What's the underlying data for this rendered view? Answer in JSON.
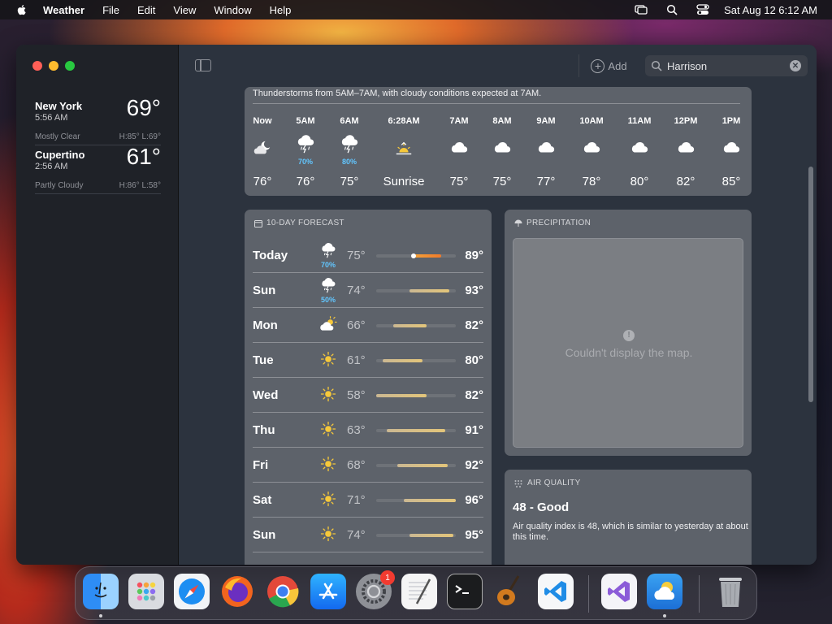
{
  "menubar": {
    "app_name": "Weather",
    "items": [
      "File",
      "Edit",
      "View",
      "Window",
      "Help"
    ],
    "clock": "Sat Aug 12  6:12 AM"
  },
  "sidebar": {
    "cities": [
      {
        "name": "New York",
        "time": "5:56 AM",
        "temp": "69°",
        "condition": "Mostly Clear",
        "hilo": "H:85°  L:69°"
      },
      {
        "name": "Cupertino",
        "time": "2:56 AM",
        "temp": "61°",
        "condition": "Partly Cloudy",
        "hilo": "H:86°  L:58°"
      }
    ]
  },
  "toolbar": {
    "add_label": "Add",
    "search_value": "Harrison"
  },
  "hourly": {
    "summary": "Thunderstorms from 5AM–7AM, with cloudy conditions expected at 7AM.",
    "hours": [
      {
        "label": "Now",
        "icon": "moon-cloud-icon",
        "precip": "",
        "temp": "76°"
      },
      {
        "label": "5AM",
        "icon": "thunderstorm-icon",
        "precip": "70%",
        "temp": "76°"
      },
      {
        "label": "6AM",
        "icon": "thunderstorm-icon",
        "precip": "80%",
        "temp": "75°"
      },
      {
        "label": "6:28AM",
        "icon": "sunrise-icon",
        "precip": "",
        "temp": "Sunrise"
      },
      {
        "label": "7AM",
        "icon": "cloud-icon",
        "precip": "",
        "temp": "75°"
      },
      {
        "label": "8AM",
        "icon": "cloud-icon",
        "precip": "",
        "temp": "75°"
      },
      {
        "label": "9AM",
        "icon": "cloud-icon",
        "precip": "",
        "temp": "77°"
      },
      {
        "label": "10AM",
        "icon": "cloud-icon",
        "precip": "",
        "temp": "78°"
      },
      {
        "label": "11AM",
        "icon": "cloud-icon",
        "precip": "",
        "temp": "80°"
      },
      {
        "label": "12PM",
        "icon": "cloud-icon",
        "precip": "",
        "temp": "82°"
      },
      {
        "label": "1PM",
        "icon": "cloud-icon",
        "precip": "",
        "temp": "85°"
      }
    ]
  },
  "tenday": {
    "title": "10-DAY FORECAST",
    "range_min": 58,
    "range_max": 96,
    "days": [
      {
        "name": "Today",
        "icon": "thunderstorm-icon",
        "precip": "70%",
        "low": "75°",
        "high": "89°",
        "low_n": 75,
        "high_n": 89,
        "current": 76
      },
      {
        "name": "Sun",
        "icon": "thunderstorm-icon",
        "precip": "50%",
        "low": "74°",
        "high": "93°",
        "low_n": 74,
        "high_n": 93
      },
      {
        "name": "Mon",
        "icon": "partly-cloudy-icon",
        "precip": "",
        "low": "66°",
        "high": "82°",
        "low_n": 66,
        "high_n": 82
      },
      {
        "name": "Tue",
        "icon": "sun-icon",
        "precip": "",
        "low": "61°",
        "high": "80°",
        "low_n": 61,
        "high_n": 80
      },
      {
        "name": "Wed",
        "icon": "sun-icon",
        "precip": "",
        "low": "58°",
        "high": "82°",
        "low_n": 58,
        "high_n": 82
      },
      {
        "name": "Thu",
        "icon": "sun-icon",
        "precip": "",
        "low": "63°",
        "high": "91°",
        "low_n": 63,
        "high_n": 91
      },
      {
        "name": "Fri",
        "icon": "sun-icon",
        "precip": "",
        "low": "68°",
        "high": "92°",
        "low_n": 68,
        "high_n": 92
      },
      {
        "name": "Sat",
        "icon": "sun-icon",
        "precip": "",
        "low": "71°",
        "high": "96°",
        "low_n": 71,
        "high_n": 96
      },
      {
        "name": "Sun",
        "icon": "sun-icon",
        "precip": "",
        "low": "74°",
        "high": "95°",
        "low_n": 74,
        "high_n": 95
      }
    ]
  },
  "precipitation": {
    "title": "PRECIPITATION",
    "message": "Couldn't display the map."
  },
  "air_quality": {
    "title": "AIR QUALITY",
    "value": "48 - Good",
    "description": "Air quality index is 48, which is similar to yesterday at about this time."
  },
  "dock": {
    "items": [
      "Finder",
      "Launchpad",
      "Safari",
      "Firefox",
      "Chrome",
      "App Store",
      "System Settings",
      "TextEdit",
      "Terminal",
      "GarageBand",
      "Visual Studio Code",
      "Visual Studio",
      "Weather",
      "Trash"
    ],
    "settings_badge": "1"
  }
}
